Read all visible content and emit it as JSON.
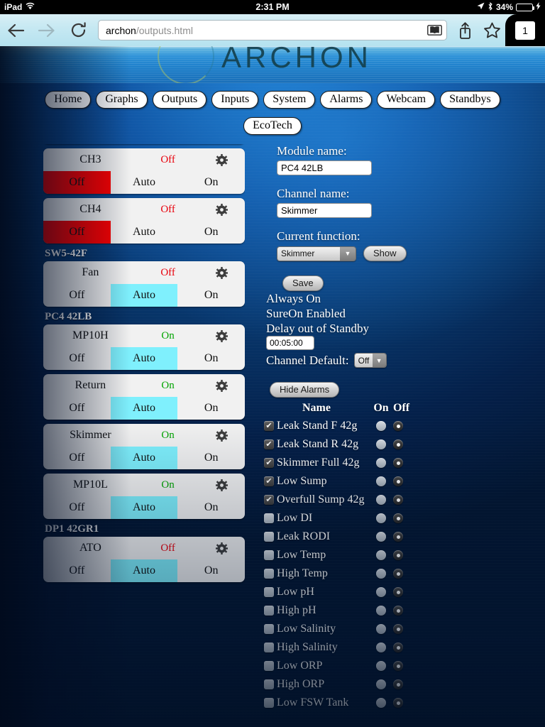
{
  "status_bar": {
    "device": "iPad",
    "wifi_icon": "wifi-icon",
    "time": "2:31 PM",
    "location_icon": "location-arrow-icon",
    "bluetooth_icon": "bluetooth-icon",
    "battery_percent": "34%",
    "battery_icon": "battery-icon",
    "charging_icon": "lightning-bolt-icon"
  },
  "browser": {
    "back_icon": "back-arrow-icon",
    "forward_icon": "forward-arrow-icon",
    "reload_icon": "reload-icon",
    "url_main": "archon",
    "url_rest": "/outputs.html",
    "reader_icon": "reader-view-icon",
    "share_icon": "share-icon",
    "bookmark_icon": "bookmark-star-icon",
    "tab_count": "1"
  },
  "site": {
    "logo_text": "ARCHON",
    "nav_primary": [
      "Home",
      "Graphs",
      "Outputs",
      "Inputs",
      "System",
      "Alarms",
      "Webcam",
      "Standbys"
    ],
    "nav_secondary": [
      "EcoTech"
    ]
  },
  "segments": {
    "off": "Off",
    "auto": "Auto",
    "on": "On"
  },
  "channels": [
    {
      "kind": "card-partial",
      "name": "",
      "state": "",
      "selected": "auto",
      "gear_icon": "gear-icon"
    },
    {
      "kind": "card",
      "name": "CH3",
      "state": "Off",
      "state_class": "off",
      "selected": "off",
      "gear_icon": "gear-icon"
    },
    {
      "kind": "card",
      "name": "CH4",
      "state": "Off",
      "state_class": "off",
      "selected": "off",
      "gear_icon": "gear-icon"
    },
    {
      "kind": "group",
      "label": "SW5-42F"
    },
    {
      "kind": "card",
      "name": "Fan",
      "state": "Off",
      "state_class": "off",
      "selected": "auto",
      "gear_icon": "gear-icon"
    },
    {
      "kind": "group",
      "label": "PC4 42LB"
    },
    {
      "kind": "card",
      "name": "MP10H",
      "state": "On",
      "state_class": "on",
      "selected": "auto",
      "gear_icon": "gear-icon"
    },
    {
      "kind": "card",
      "name": "Return",
      "state": "On",
      "state_class": "on",
      "selected": "auto",
      "gear_icon": "gear-icon"
    },
    {
      "kind": "card",
      "name": "Skimmer",
      "state": "On",
      "state_class": "on",
      "selected": "auto",
      "gear_icon": "gear-icon"
    },
    {
      "kind": "card",
      "name": "MP10L",
      "state": "On",
      "state_class": "on",
      "selected": "auto",
      "gear_icon": "gear-icon"
    },
    {
      "kind": "group",
      "label": "DP1 42GR1"
    },
    {
      "kind": "card",
      "name": "ATO",
      "state": "Off",
      "state_class": "off",
      "selected": "auto",
      "gear_icon": "gear-icon"
    }
  ],
  "form": {
    "module_label": "Module name:",
    "module_value": "PC4 42LB",
    "channel_label": "Channel name:",
    "channel_value": "Skimmer",
    "function_label": "Current function:",
    "function_value": "Skimmer",
    "show_label": "Show",
    "save_label": "Save",
    "prop_always_on": "Always On",
    "prop_sureon": "SureOn Enabled",
    "prop_delay": "Delay out of Standby",
    "delay_value": "00:05:00",
    "channel_default_label": "Channel Default:",
    "channel_default_value": "Off",
    "hide_alarms_label": "Hide Alarms"
  },
  "alarms": {
    "header": {
      "name": "Name",
      "on": "On",
      "off": "Off"
    },
    "check_glyph": "✔",
    "rows": [
      {
        "name": "Leak Stand F 42g",
        "checked": true,
        "mode": "off"
      },
      {
        "name": "Leak Stand R 42g",
        "checked": true,
        "mode": "off"
      },
      {
        "name": "Skimmer Full 42g",
        "checked": true,
        "mode": "off"
      },
      {
        "name": "Low Sump",
        "checked": true,
        "mode": "off"
      },
      {
        "name": "Overfull Sump 42g",
        "checked": true,
        "mode": "off"
      },
      {
        "name": "Low DI",
        "checked": false,
        "mode": "off"
      },
      {
        "name": "Leak RODI",
        "checked": false,
        "mode": "off"
      },
      {
        "name": "Low Temp",
        "checked": false,
        "mode": "off"
      },
      {
        "name": "High Temp",
        "checked": false,
        "mode": "off"
      },
      {
        "name": "Low pH",
        "checked": false,
        "mode": "off"
      },
      {
        "name": "High pH",
        "checked": false,
        "mode": "off"
      },
      {
        "name": "Low Salinity",
        "checked": false,
        "mode": "off"
      },
      {
        "name": "High Salinity",
        "checked": false,
        "mode": "off"
      },
      {
        "name": "Low ORP",
        "checked": false,
        "mode": "off"
      },
      {
        "name": "High ORP",
        "checked": false,
        "mode": "off"
      },
      {
        "name": "Low FSW Tank",
        "checked": false,
        "mode": "off"
      }
    ]
  },
  "colors": {
    "selected_auto": "#7ff0fd",
    "selected_off": "#fc0000",
    "state_on": "#00a400",
    "state_off": "#e8000b",
    "background_deep": "#02132c"
  }
}
